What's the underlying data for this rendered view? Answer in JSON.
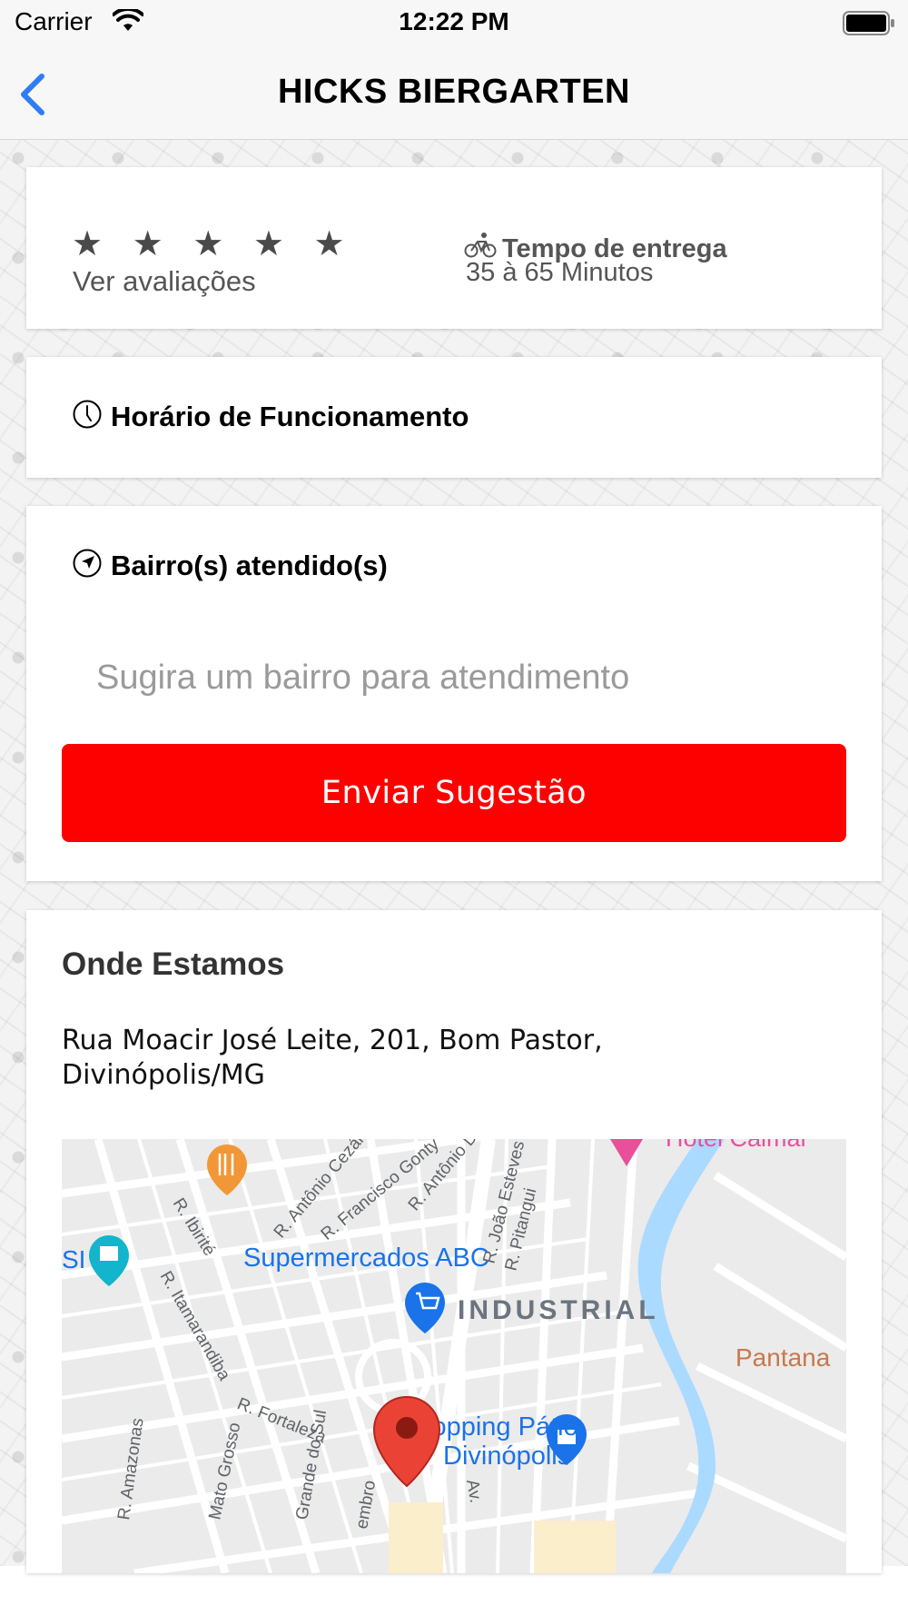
{
  "status_bar": {
    "carrier": "Carrier",
    "time": "12:22 PM",
    "wifi_icon": "wifi-icon",
    "battery_icon": "battery-icon"
  },
  "nav": {
    "title": "HICKS BIERGARTEN",
    "back_icon": "chevron-left-icon"
  },
  "ratings": {
    "stars": "★ ★ ★ ★ ★",
    "link": "Ver avaliações",
    "delivery_icon": "bicycle-icon",
    "delivery_title": "Tempo de entrega",
    "delivery_time": "35 à 65 Minutos"
  },
  "hours": {
    "icon": "clock-icon",
    "title": "Horário de Funcionamento"
  },
  "bairro": {
    "icon": "navigation-arrow-icon",
    "title": "Bairro(s) atendido(s)",
    "input_placeholder": "Sugira um bairro para atendimento",
    "input_value": "",
    "button_label": "Enviar Sugestão"
  },
  "location": {
    "title": "Onde Estamos",
    "address_line1": "Rua Moacir José Leite, 201, Bom Pastor,",
    "address_line2": "Divinópolis/MG",
    "map": {
      "labels": {
        "hotel": "Hotel Caimar",
        "si": "SI",
        "supermarket": "Supermercados ABC",
        "industrial": "INDUSTRIAL",
        "pantanal": "Pantana",
        "shopping_line1": "Shopping Pátio",
        "shopping_line2": "Divinópolis",
        "r_ibirite": "R. Ibirité",
        "r_antonio_cezario": "R. Antônio Cezário",
        "r_francisco_gonty": "R. Francisco Gonty",
        "r_antonio_di": "R. Antônio Di",
        "r_joao_esteves": "R. João Esteves",
        "r_pitangui": "R. Pitangui",
        "r_itamarandiba": "R. Itamarandiba",
        "r_fortaleza": "R. Fortaleza",
        "r_amazonas": "R. Amazonas",
        "r_mato_grosso": "Mato Grosso",
        "r_grande_do_sul": "Grande do Sul",
        "r_embro": "embro",
        "av": "Av."
      },
      "colors": {
        "water": "#aadaff",
        "road": "#ffffff",
        "land": "#ebebeb",
        "pin": "#ea4335",
        "poi_blue": "#1a73e8",
        "poi_teal": "#12b5cb",
        "poi_orange": "#f29737"
      }
    }
  },
  "colors": {
    "accent": "#fd0000",
    "back_blue": "#2f7cf6"
  }
}
